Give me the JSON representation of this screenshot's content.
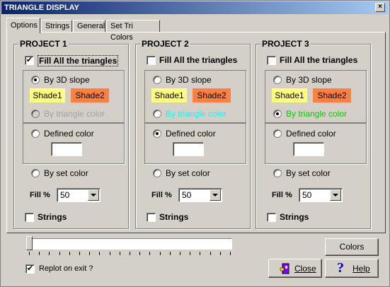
{
  "window": {
    "title": "TRIANGLE DISPLAY",
    "close_glyph": "×"
  },
  "tabs": [
    {
      "label": "Options",
      "active": true
    },
    {
      "label": "Strings"
    },
    {
      "label": "General"
    },
    {
      "label": "Set Tri Colors"
    }
  ],
  "projects": [
    {
      "title": "PROJECT 1",
      "fill_all_label": "Fill All the triangles",
      "fill_all_checked": true,
      "by_3d_slope_label": "By 3D slope",
      "shade1_label": "Shade1",
      "shade2_label": "Shade2",
      "by_triangle_color_label": "By triangle color",
      "triangle_color_state": "disabled",
      "defined_color_label": "Defined color",
      "by_set_color_label": "By set color",
      "fill_label": "Fill %",
      "fill_value": "50",
      "strings_label": "Strings",
      "selected": "by_3d_slope"
    },
    {
      "title": "PROJECT 2",
      "fill_all_label": "Fill All the triangles",
      "fill_all_checked": false,
      "by_3d_slope_label": "By 3D slope",
      "shade1_label": "Shade1",
      "shade2_label": "Shade2",
      "by_triangle_color_label": "By triangle color",
      "triangle_color_state": "cyan",
      "defined_color_label": "Defined color",
      "by_set_color_label": "By set color",
      "fill_label": "Fill %",
      "fill_value": "50",
      "strings_label": "Strings",
      "selected": "defined_color"
    },
    {
      "title": "PROJECT 3",
      "fill_all_label": "Fill All the triangles",
      "fill_all_checked": false,
      "by_3d_slope_label": "By 3D slope",
      "shade1_label": "Shade1",
      "shade2_label": "Shade2",
      "by_triangle_color_label": "By triangle color",
      "triangle_color_state": "green",
      "defined_color_label": "Defined color",
      "by_set_color_label": "By set color",
      "fill_label": "Fill %",
      "fill_value": "50",
      "strings_label": "Strings",
      "selected": "by_triangle_color"
    }
  ],
  "footer": {
    "replot_label": "Replot on exit ?",
    "replot_checked": true,
    "colors_button": "Colors",
    "close_button": "Close",
    "help_button": "Help"
  },
  "colors": {
    "shade1": "#ffff80",
    "shade2": "#ff8040",
    "disabled_text": "#a0a0a0",
    "cyan_text": "#00ffff",
    "green_text": "#00cc00"
  }
}
